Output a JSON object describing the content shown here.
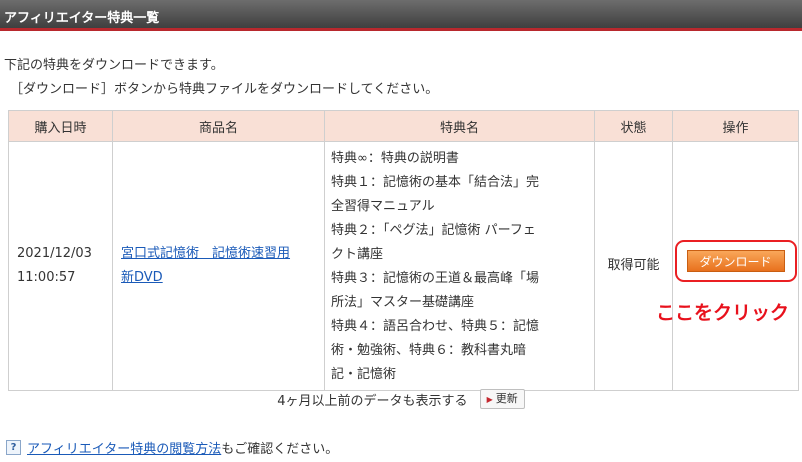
{
  "header": {
    "title": "アフィリエイター特典一覧"
  },
  "intro": {
    "line1": "下記の特典をダウンロードできます。",
    "line2": "［ダウンロード］ボタンから特典ファイルをダウンロードしてください。"
  },
  "table": {
    "columns": [
      "購入日時",
      "商品名",
      "特典名",
      "状態",
      "操作"
    ],
    "rows": [
      {
        "date": "2021/12/03",
        "time": "11:00:57",
        "product_line1": "宮口式記憶術　記憶術速習用",
        "product_line2": "新DVD",
        "bonus_lines": [
          "特典∞：特典の説明書",
          "特典１：記憶術の基本「結合法」完",
          "全習得マニュアル",
          "特典２：「ペグ法」記憶術 パーフェ",
          "クト講座",
          "特典３：記憶術の王道＆最高峰「場",
          "所法」マスター基礎講座",
          "特典４：語呂合わせ、特典５：記憶",
          "術・勉強術、特典６：教科書丸暗",
          "記・記憶術"
        ],
        "status": "取得可能",
        "action_label": "ダウンロード"
      }
    ]
  },
  "annotation": {
    "text": "ここをクリック",
    "color": "#e8111c"
  },
  "older": {
    "text": "4ヶ月以上前のデータも表示する",
    "button_label": "更新"
  },
  "footer": {
    "link_text": "アフィリエイター特典の閲覧方法",
    "rest_text": "もご確認ください。",
    "help_icon_glyph": "?"
  },
  "colors": {
    "accent": "#b8282d",
    "button": "#e8711d",
    "header_bg": "#f9e0d6",
    "link": "#1a5ab8"
  }
}
